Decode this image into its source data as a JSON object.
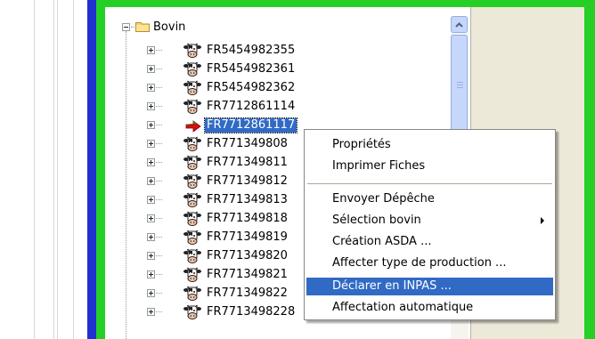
{
  "tree": {
    "root_label": "Bovin",
    "nodes": [
      {
        "label": "FR5454982355",
        "icon": "cow-icon"
      },
      {
        "label": "FR5454982361",
        "icon": "cow-icon"
      },
      {
        "label": "FR5454982362",
        "icon": "cow-icon"
      },
      {
        "label": "FR7712861114",
        "icon": "cow-icon"
      },
      {
        "label": "FR7712861117",
        "icon": "arrow-icon",
        "selected": true
      },
      {
        "label": "FR771349808",
        "icon": "cow-icon"
      },
      {
        "label": "FR771349811",
        "icon": "cow-icon"
      },
      {
        "label": "FR771349812",
        "icon": "cow-icon"
      },
      {
        "label": "FR771349813",
        "icon": "cow-icon"
      },
      {
        "label": "FR771349818",
        "icon": "cow-icon"
      },
      {
        "label": "FR771349819",
        "icon": "cow-icon"
      },
      {
        "label": "FR771349820",
        "icon": "cow-icon"
      },
      {
        "label": "FR771349821",
        "icon": "cow-icon"
      },
      {
        "label": "FR771349822",
        "icon": "cow-icon"
      },
      {
        "label": "FR7713498228",
        "icon": "cow-icon"
      }
    ]
  },
  "context_menu": {
    "items": [
      {
        "label": "Propriétés"
      },
      {
        "label": "Imprimer Fiches"
      },
      {
        "label": "Envoyer Dépêche"
      },
      {
        "label": "Sélection bovin",
        "submenu": true
      },
      {
        "label": "Création ASDA ..."
      },
      {
        "label": "Affecter type de production ..."
      },
      {
        "label": "Déclarer en INPAS ...",
        "highlighted": true
      },
      {
        "label": "Affectation automatique"
      }
    ]
  },
  "colors": {
    "frame_blue": "#1f2fd0",
    "frame_green": "#25cf25",
    "selection": "#316ac5"
  }
}
